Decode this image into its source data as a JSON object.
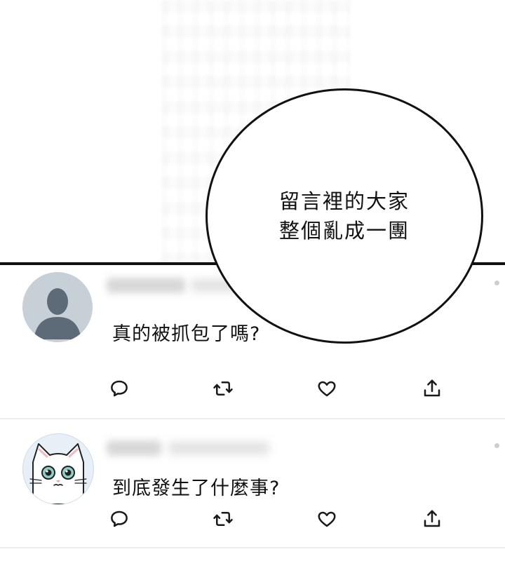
{
  "speech_bubble": {
    "line1": "留言裡的大家",
    "line2": "整個亂成一團"
  },
  "tweets": [
    {
      "avatar": "default-user-avatar",
      "text": "真的被抓包了嗎?"
    },
    {
      "avatar": "cat-avatar",
      "text": "到底發生了什麼事?"
    }
  ],
  "action_icons": [
    "reply-icon",
    "retweet-icon",
    "like-icon",
    "share-icon"
  ],
  "colors": {
    "icon": "#1a1a1a",
    "separator": "#ececec",
    "panel_border": "#111111",
    "default_avatar_bg": "#c7cfd7",
    "default_avatar_fg": "#5d6b79"
  }
}
